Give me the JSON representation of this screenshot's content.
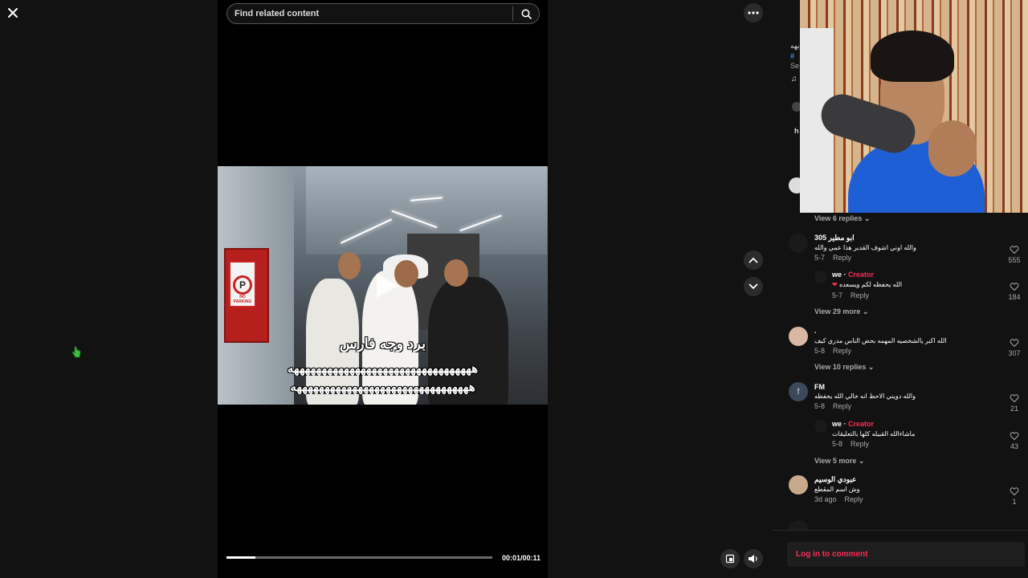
{
  "search": {
    "placeholder": "Find related content"
  },
  "player": {
    "captions": [
      "برد وجه فارس",
      "هههههههههههههههههههههههههههههههههه",
      "ههههههههههههههههههههههههههههههههه"
    ],
    "time": "00:01/00:11",
    "progress_fraction": 0.11,
    "sign_text": "NO PARKING",
    "sign_label": "P"
  },
  "panel_top": {
    "fragments": [
      "بهه",
      "#",
      "Se",
      "h"
    ]
  },
  "comments": [
    {
      "type": "view_more",
      "label": "View 6 replies"
    },
    {
      "type": "comment",
      "user": "ابو مطير 305",
      "text": "والله اوني اشوف القدير هذا عمي والله",
      "date": "5-7",
      "reply": "Reply",
      "likes": "555"
    },
    {
      "type": "reply",
      "user": "we",
      "badge": "Creator",
      "text": "الله يحفظه لكم ويسعده",
      "date": "5-7",
      "reply": "Reply",
      "likes": "184"
    },
    {
      "type": "view_more",
      "label": "View 29 more"
    },
    {
      "type": "comment",
      "user": ".",
      "text": "الله اكبر يالشخصيه المهمه بحض الناس مدري كيف",
      "date": "5-8",
      "reply": "Reply",
      "likes": "307"
    },
    {
      "type": "view_more",
      "label": "View 10 replies"
    },
    {
      "type": "comment",
      "user": "FM",
      "avatar_letter": "f",
      "text": "والله دويني الاحظ انه خالي الله يحفظه",
      "date": "5-8",
      "reply": "Reply",
      "likes": "21"
    },
    {
      "type": "reply",
      "user": "we",
      "badge": "Creator",
      "text": "ماشاءالله القبيله كلها بالتعليقات",
      "date": "5-8",
      "reply": "Reply",
      "likes": "43"
    },
    {
      "type": "view_more",
      "label": "View 5 more"
    },
    {
      "type": "comment",
      "user": "عبودي الوسيم",
      "text": "وش اسم المقطع",
      "date": "3d ago",
      "reply": "Reply",
      "likes": "1"
    }
  ],
  "login": {
    "label": "Log in to comment"
  },
  "colors": {
    "accent": "#fe2c55",
    "background": "#121212",
    "video_bg": "#000000"
  }
}
